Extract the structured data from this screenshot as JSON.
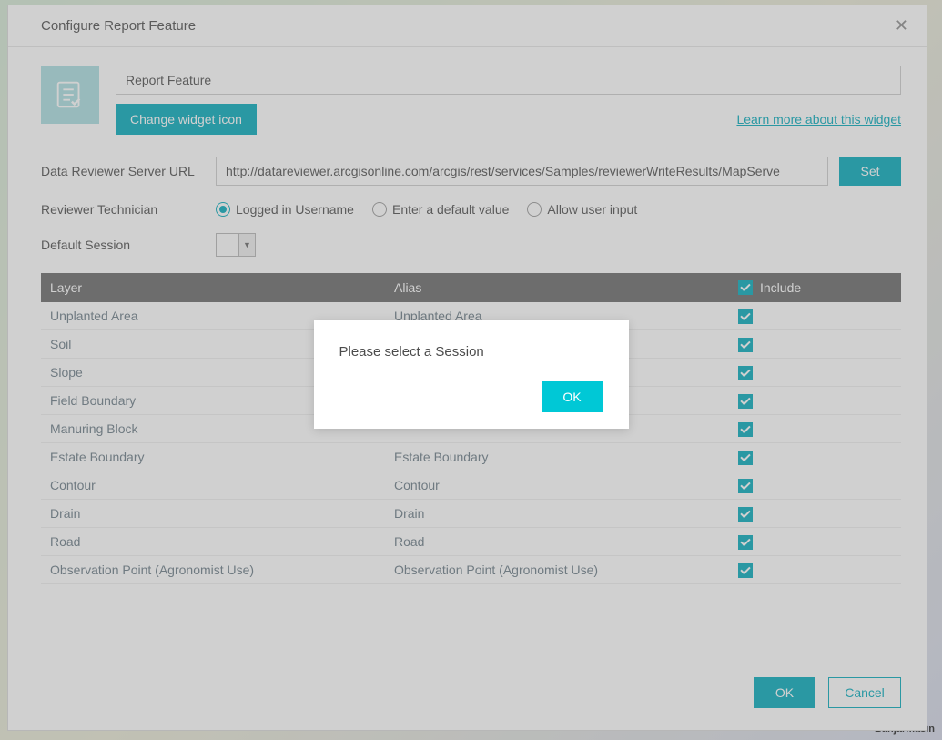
{
  "dialog": {
    "title": "Configure Report Feature",
    "widget_name": "Report Feature",
    "change_icon_label": "Change widget icon",
    "learn_link": "Learn more about this widget"
  },
  "fields": {
    "url_label": "Data Reviewer Server URL",
    "url_value": "http://datareviewer.arcgisonline.com/arcgis/rest/services/Samples/reviewerWriteResults/MapServe",
    "set_label": "Set",
    "tech_label": "Reviewer Technician",
    "radio_logged": "Logged in Username",
    "radio_default": "Enter a default value",
    "radio_user": "Allow user input",
    "session_label": "Default Session"
  },
  "table": {
    "col_layer": "Layer",
    "col_alias": "Alias",
    "col_include": "Include",
    "rows": [
      {
        "layer": "Unplanted Area",
        "alias": "Unplanted Area"
      },
      {
        "layer": "Soil",
        "alias": ""
      },
      {
        "layer": "Slope",
        "alias": ""
      },
      {
        "layer": "Field Boundary",
        "alias": ""
      },
      {
        "layer": "Manuring Block",
        "alias": ""
      },
      {
        "layer": "Estate Boundary",
        "alias": "Estate Boundary"
      },
      {
        "layer": "Contour",
        "alias": "Contour"
      },
      {
        "layer": "Drain",
        "alias": "Drain"
      },
      {
        "layer": "Road",
        "alias": "Road"
      },
      {
        "layer": "Observation Point (Agronomist Use)",
        "alias": "Observation Point (Agronomist Use)"
      }
    ]
  },
  "footer": {
    "ok": "OK",
    "cancel": "Cancel"
  },
  "modal": {
    "message": "Please select a Session",
    "ok": "OK"
  },
  "map_label": "Banjarmasin"
}
